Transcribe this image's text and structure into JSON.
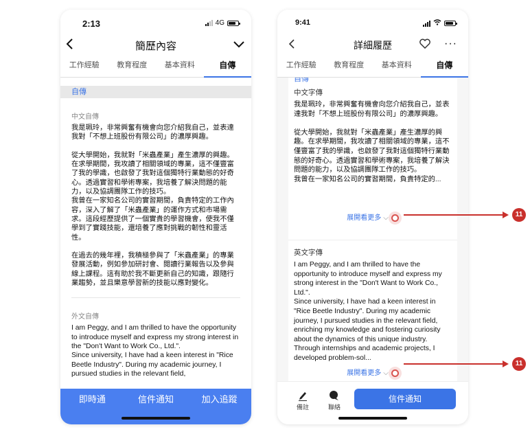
{
  "left_phone": {
    "time": "2:13",
    "network": "4G",
    "title": "簡歷內容",
    "tabs": [
      "工作經驗",
      "教育程度",
      "基本資料",
      "自傳"
    ],
    "section_header": "自傳",
    "chinese_label": "中文自傳",
    "chinese_text": "我是珮玲，非常興奮有機會向您介紹我自己，並表達我對「不想上班股份有限公司」的濃厚興趣。\n\n從大學開始，我就對「米蟲產業」產生濃厚的興趣。在求學期間，我攻讀了相關領域的專業，這不僅豐富了我的學識，也啟發了我對這個獨特行業動態的好奇心。透過實習和學術專案，我培養了解決問題的能力，以及協調團隊工作的技巧。\n我曾在一家知名公司的實習期間，負責特定的工作內容，深入了解了「米蟲產業」的運作方式和市場需求。這段經歷提供了一個實貴的學習機會，使我不僅學到了實踐技能，還培養了應對挑戰的韌性和靈活性。\n\n在過去的幾年裡，我積極參與了「米蟲產業」的專業發展活動，例如參加研討會、閱讀行業報告以及參與線上課程。這有助於我不斷更新自己的知識，跟隨行業趨勢，並且樂意學習新的技能以應對變化。",
    "english_label": "外文自傳",
    "english_text": "I am Peggy, and I am thrilled to have the opportunity to introduce myself and express my strong interest in the \"Don't Want to Work Co., Ltd.\".\nSince university, I have had a keen interest in \"Rice Beetle Industry\". During my academic journey, I pursued studies in the relevant field,",
    "bottom_actions": [
      "即時通",
      "信件通知",
      "加入追蹤"
    ]
  },
  "right_phone": {
    "time": "9:41",
    "title": "詳細履歷",
    "tabs": [
      "工作經驗",
      "教育程度",
      "基本資料",
      "自傳"
    ],
    "top_partial": "自傳",
    "chinese_label": "中文字傳",
    "chinese_text": "我是珮玲，非常興奮有機會向您介紹我自己，並表達我對「不想上班股份有限公司」的濃厚興趣。\n\n從大學開始，我就對「米蟲產業」產生濃厚的興趣。在求學期間，我攻讀了相關領域的專業，這不僅豐富了我的學識，也啟發了我對這個獨特行業動態的好奇心。透過實習和學術專案，我培養了解決問題的能力，以及協調團隊工作的技巧。\n我曾在一家知名公司的實習期間，負責特定的...",
    "english_label": "英文字傳",
    "english_text": "I am Peggy, and I am thrilled to have the opportunity to introduce myself and express my strong interest in the \"Don't Want to Work Co., Ltd.\".\nSince university, I have had a keen interest in \"Rice Beetle Industry\". During my academic journey, I pursued studies in the relevant field, enriching my knowledge and fostering curiosity about the dynamics of this unique industry. Through internships and academic projects, I developed problem-sol...",
    "expand_label": "展開看更多",
    "footer": {
      "note": "備註",
      "contact": "聯絡",
      "cta": "信件通知"
    }
  },
  "annotations": {
    "badge_1": "11",
    "badge_2": "11"
  },
  "colors": {
    "accent": "#3b74e6",
    "annotation": "#c9302c"
  }
}
